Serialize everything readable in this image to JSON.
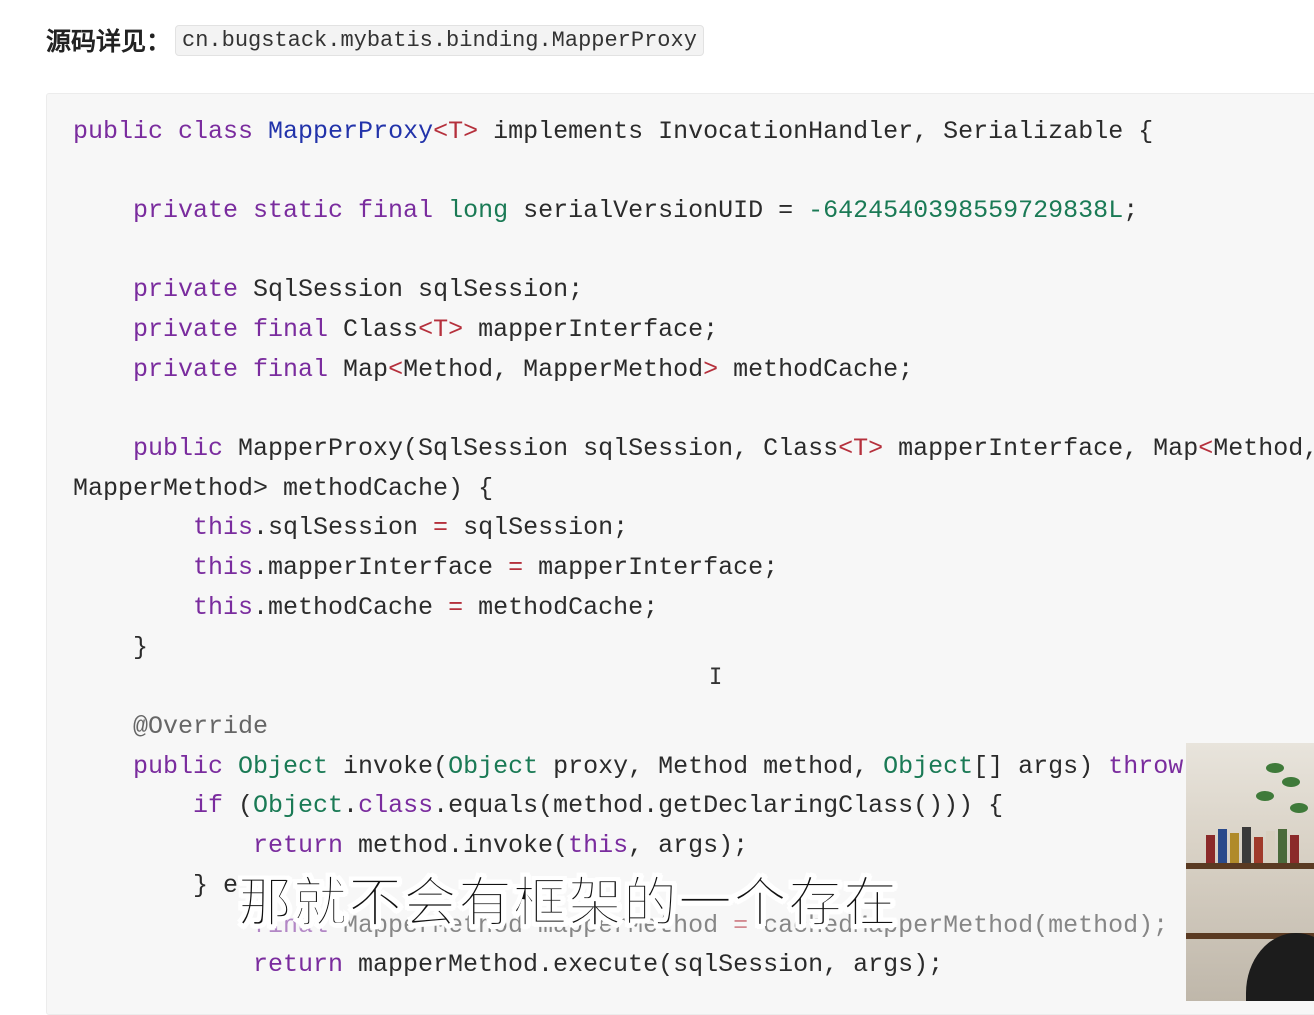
{
  "source": {
    "label": "源码详见：",
    "path": "cn.bugstack.mybatis.binding.MapperProxy"
  },
  "code": {
    "line1": [
      "public class ",
      "MapperProxy",
      "<T>",
      " implements InvocationHandler, Serializable {"
    ],
    "line2": [
      "private static final ",
      "long",
      " serialVersionUID = ",
      "-6424540398559729838L",
      ";"
    ],
    "line3": [
      "private",
      " SqlSession sqlSession;"
    ],
    "line4": [
      "private final",
      " Class",
      "<T>",
      " mapperInterface;"
    ],
    "line5": [
      "private final",
      " Map",
      "<",
      "Method, MapperMethod",
      ">",
      " methodCache;"
    ],
    "line6": [
      "public",
      " MapperProxy(SqlSession sqlSession, Class",
      "<T>",
      " mapperInterface, Map",
      "<",
      "Method,"
    ],
    "line7": "MapperMethod> methodCache) {",
    "line8": [
      "this",
      ".sqlSession ",
      "=",
      " sqlSession;"
    ],
    "line9": [
      "this",
      ".mapperInterface ",
      "=",
      " mapperInterface;"
    ],
    "line10": [
      "this",
      ".methodCache ",
      "=",
      " methodCache;"
    ],
    "line11": "}",
    "line12": "@Override",
    "line13": [
      "public",
      " ",
      "Object",
      " invoke(",
      "Object",
      " proxy, Method method, ",
      "Object",
      "[] args) ",
      "throw"
    ],
    "line14": [
      "if",
      " (",
      "Object",
      ".",
      "class",
      ".equals(method.getDeclaringClass())) {"
    ],
    "line15": [
      "return",
      " method.invoke(",
      "this",
      ", args);"
    ],
    "line16": "} e",
    "line17": [
      "final",
      " MapperMethod mapperMethod ",
      "=",
      " cachedMapperMethod(method);"
    ],
    "line18": [
      "return",
      " mapperMethod.execute(sqlSession, args);"
    ]
  },
  "subtitle": "那就不会有框架的一个存在",
  "cursor_glyph": "I"
}
